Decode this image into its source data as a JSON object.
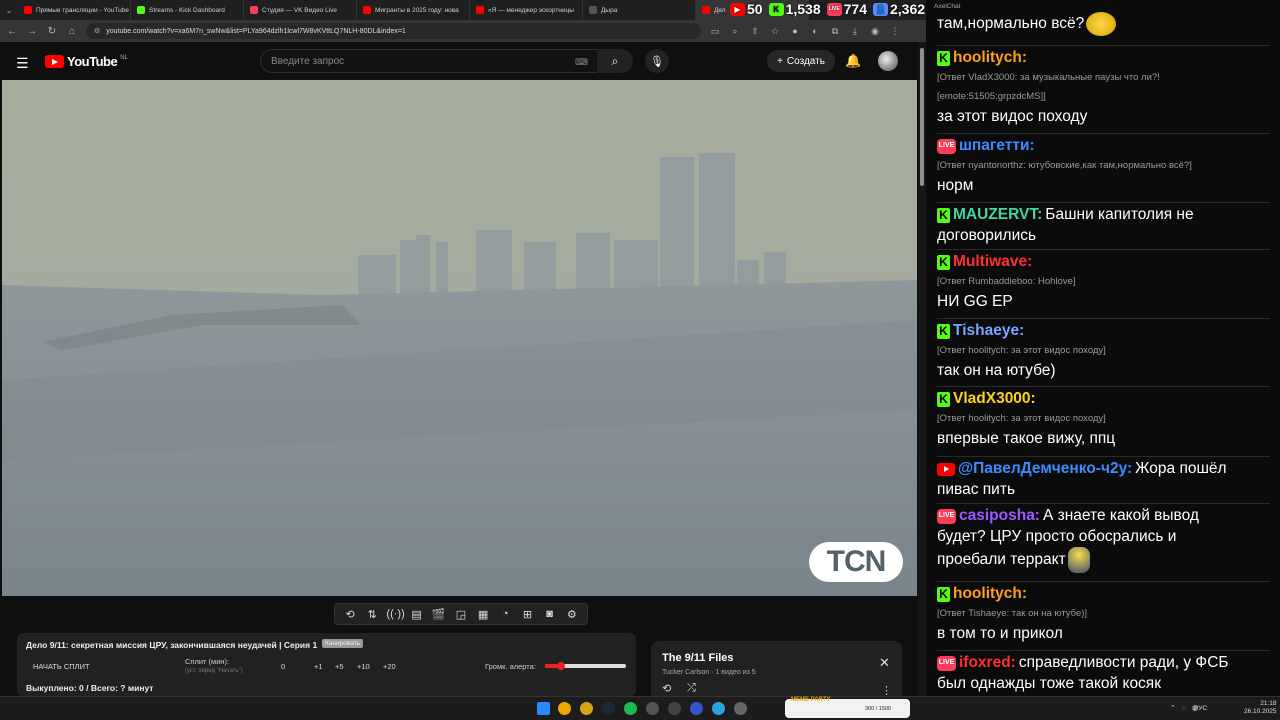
{
  "browser": {
    "tabs": [
      {
        "label": "Прямые трансляции - YouTube",
        "color": "#ff0000",
        "active": false
      },
      {
        "label": "Streams - Kick Dashboard",
        "color": "#53fc18",
        "active": false
      },
      {
        "label": "Студия — VK Видео Live",
        "color": "#ff3b5c",
        "active": false
      },
      {
        "label": "Мигранты в 2025 году: нова",
        "color": "#ff0000",
        "active": false
      },
      {
        "label": "«Я — менеджер эскортницы",
        "color": "#ff0000",
        "active": false
      },
      {
        "label": "Дыра",
        "color": "#555555",
        "active": false
      },
      {
        "label": "Дел",
        "color": "#ff0000",
        "active": true
      }
    ],
    "url": "youtube.com/watch?v=xa6M7n_swNw&list=PLYa964dzlh1lcwl7W8vKVttLQ7NLH-80DL&index=1"
  },
  "stats": [
    {
      "icon": "youtube-icon",
      "value": "50",
      "color": "#ff0000"
    },
    {
      "icon": "kick-icon",
      "value": "1,538",
      "color": "#53fc18"
    },
    {
      "icon": "vk-live-icon",
      "value": "774",
      "color": "#ff3b5c"
    },
    {
      "icon": "viewers-icon",
      "value": "2,362",
      "color": "#5b8cff"
    }
  ],
  "youtube": {
    "logo_text": "YouTube",
    "region": "NL",
    "search_placeholder": "Введите запрос",
    "create_label": "Создать"
  },
  "video": {
    "watermark": "TCN"
  },
  "split_panel": {
    "title": "Дело 9/11: секретная миссия ЦРУ, закончившаяся неудачей | Серия 1",
    "badge": "Канировать",
    "start_label": "НАЧАТЬ СПЛИТ",
    "split_label": "Сплит (мин):",
    "split_hint": "(уст. перед \"Начать\")",
    "values": [
      "0",
      "+1",
      "+5",
      "+10",
      "+20"
    ],
    "alert_label": "Громк. алерта:",
    "alert_level": 0.2,
    "status": "Выкуплено: 0 / Всего: ? минут"
  },
  "playlist": {
    "title": "The 9/11 Files",
    "subtitle": "Tucker Carlson · 1 видео из 5"
  },
  "chat": {
    "window_title": "AxelChat",
    "messages": [
      {
        "platform": "none",
        "user": "",
        "color": "#ffffff",
        "reply": "",
        "text": "там,нормально всё?",
        "emoji": "laugh"
      },
      {
        "platform": "kick",
        "user": "hoolitych:",
        "color": "#ff9f1a",
        "reply": "[Ответ VladX3000: за музыкальные паузы что ли?!",
        "reply2": "[emote:51505:grpzdcMS]]",
        "text": "за этот видос походу"
      },
      {
        "platform": "vk",
        "user": "шпагетти:",
        "color": "#3d8bff",
        "reply": "[Ответ nyantonorthz: ютубовские,как там,нормально всё?]",
        "text": "норм"
      },
      {
        "platform": "kick",
        "user": "MAUZERVT:",
        "color": "#3fd6a6",
        "inline": "Башни капитолия не",
        "text": "договорились"
      },
      {
        "platform": "kick",
        "user": "Multiwave:",
        "color": "#ff3030",
        "reply": "[Ответ Rumbaddieboo: Hohlove]",
        "text": "НИ GG ЕР"
      },
      {
        "platform": "kick",
        "user": "Tishaeye:",
        "color": "#79a6ff",
        "reply": "[Ответ hoolitych: за этот видос походу]",
        "text": "так он на ютубе)"
      },
      {
        "platform": "kick",
        "user": "VladX3000:",
        "color": "#ffd21f",
        "reply": "[Ответ hoolitych: за этот видос походу]",
        "text": "впервые такое вижу, ппц"
      },
      {
        "platform": "youtube",
        "user": "@ПавелДемченко-ч2у:",
        "color": "#3d8bff",
        "inline": "Жора пошёл",
        "text": "пивас пить"
      },
      {
        "platform": "vk",
        "user": "casiposha:",
        "color": "#9b59ff",
        "inline": "А знаете какой вывод",
        "text": "будет? ЦРУ просто обосрались и",
        "text2": "проебали терракт",
        "emoji": "blob"
      },
      {
        "platform": "kick",
        "user": "hoolitych:",
        "color": "#ff9f1a",
        "reply": "[Ответ Tishaeye: так он на ютубе)]",
        "text": "в том то и прикол"
      },
      {
        "platform": "vk",
        "user": "ifoxred:",
        "color": "#ff3030",
        "inline": "справедливости ради, у ФСБ",
        "text": "был однажды тоже такой косяк"
      }
    ]
  },
  "taskbar": {
    "widget_label": "MEME PARTY",
    "widget_value": "300 / 1500",
    "language": "РУС",
    "time": "21:18",
    "date": "26.10.2025"
  }
}
